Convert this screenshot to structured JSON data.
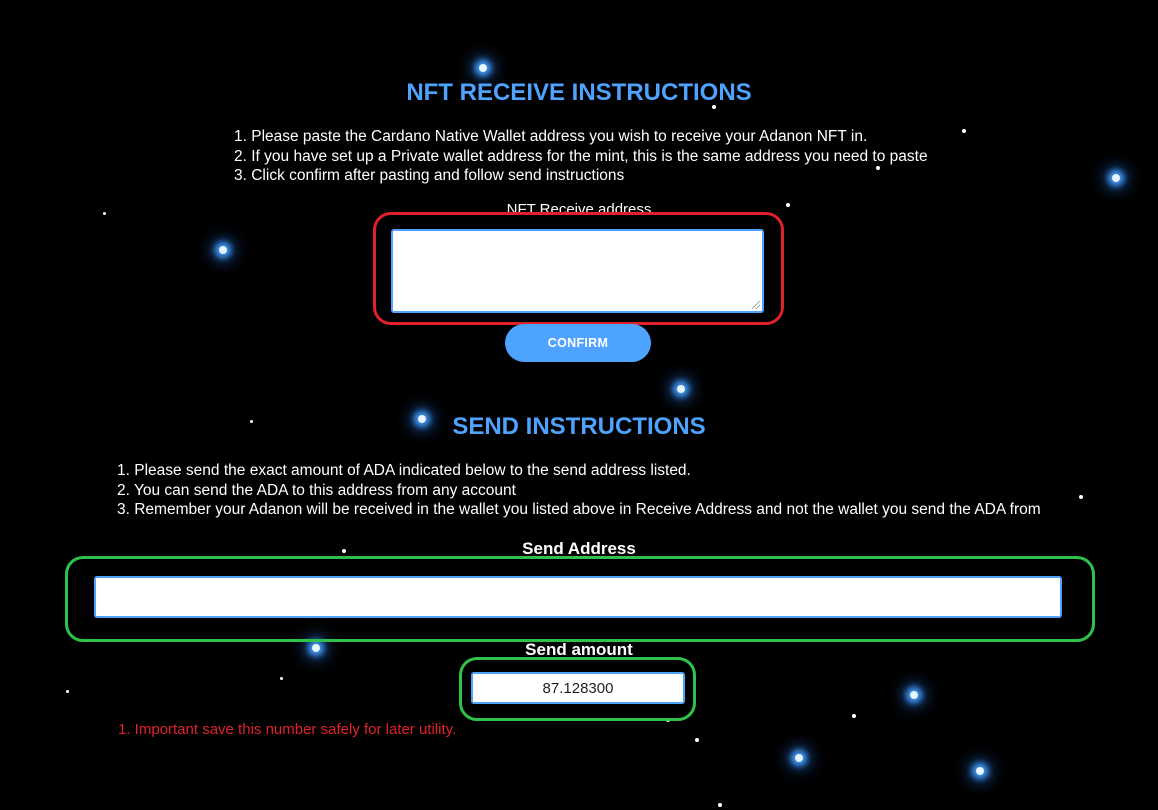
{
  "receive": {
    "heading": "NFT RECEIVE INSTRUCTIONS",
    "instructions": [
      "1. Please paste the Cardano Native Wallet address you wish to receive your Adanon NFT in.",
      "2. If you have set up a Private wallet address for the mint, this is the same address you need to paste",
      "3. Click confirm after pasting and follow send instructions"
    ],
    "field_label": "NFT Receive address",
    "field_value": "",
    "confirm_label": "CONFIRM"
  },
  "send": {
    "heading": "SEND INSTRUCTIONS",
    "instructions": [
      "1. Please send the exact amount of ADA indicated below to the send address listed.",
      "2. You can send the ADA to this address from any account",
      "3. Remember your Adanon will be received in the wallet you listed above in Receive Address and not the wallet you send the ADA from"
    ],
    "address_label": "Send Address",
    "address_value": "",
    "amount_label": "Send amount",
    "amount_value": "87.128300",
    "warning": "1. Important save this number safely for later utility."
  },
  "colors": {
    "accent": "#4ea3ff",
    "warning": "#e0202a",
    "highlight_red": "#e0202a",
    "highlight_green": "#2ec24a",
    "background": "#000000"
  },
  "icons": {
    "resize_grip": "resize-grip-icon"
  }
}
